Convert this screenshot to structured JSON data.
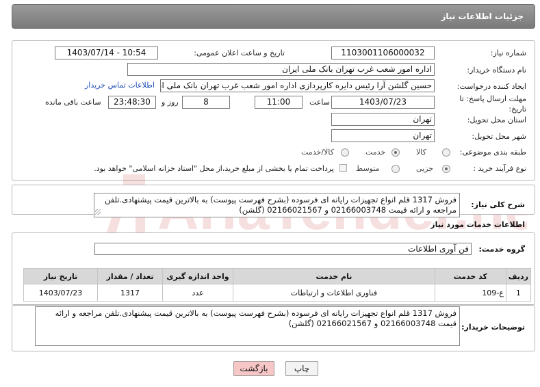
{
  "header": {
    "title": "جزئیات اطلاعات نیاز"
  },
  "form": {
    "need_number_label": "شماره نیاز:",
    "need_number": "1103001106000032",
    "announce_label": "تاریخ و ساعت اعلان عمومی:",
    "announce_value": "1403/07/14 - 10:54",
    "buyer_org_label": "نام دستگاه خریدار:",
    "buyer_org": "اداره امور شعب غرب تهران بانک ملی ایران",
    "requester_label": "ایجاد کننده درخواست:",
    "requester": "حسین گلشن آرا رئیس دایره کارپردازی اداره امور شعب غرب تهران بانک ملی ایرا",
    "buyer_contact_link": "اطلاعات تماس خریدار",
    "deadline_label": "مهلت ارسال پاسخ: تا تاریخ:",
    "deadline_date": "1403/07/23",
    "time_label": "ساعت",
    "deadline_time": "11:00",
    "days_count": "8",
    "days_label": "روز و",
    "remaining_time": "23:48:30",
    "remaining_label": "ساعت باقی مانده",
    "province_label": "استان محل تحویل:",
    "province": "تهران",
    "city_label": "شهر محل تحویل:",
    "city": "تهران",
    "category_label": "طبقه بندی موضوعی:",
    "category_options": [
      "کالا",
      "خدمت",
      "کالا/خدمت"
    ],
    "category_selected": "خدمت",
    "process_label": "نوع فرآیند خرید :",
    "process_options": [
      "جزیی",
      "متوسط"
    ],
    "process_selected": "جزیی",
    "payment_note": "پرداخت تمام یا بخشی از مبلغ خرید،از محل \"اسناد خزانه اسلامی\" خواهد بود."
  },
  "description": {
    "label": "شرح کلی نیاز:",
    "text": "فروش 1317 قلم انواع تجهیزات رایانه ای فرسوده (بشرح فهرست پیوست) به بالاترین قیمت پیشنهادی.تلفن مراجعه و ارائه قیمت 02166003748 و 02166021567  (گلشن)"
  },
  "services": {
    "section_title": "اطلاعات خدمات مورد نیاز",
    "group_label": "گروه خدمت:",
    "group_value": "فن آوری اطلاعات",
    "columns": [
      "ردیف",
      "کد خدمت",
      "نام خدمت",
      "واحد اندازه گیری",
      "تعداد / مقدار",
      "تاریخ نیاز"
    ],
    "rows": [
      {
        "row": "1",
        "code": "ع-109",
        "name": "فناوری اطلاعات و ارتباطات",
        "unit": "عدد",
        "qty": "1317",
        "date": "1403/07/23"
      }
    ]
  },
  "buyer_notes": {
    "label": "توضیحات خریدار:",
    "text": "فروش 1317 قلم انواع تجهیزات رایانه ای فرسوده (بشرح فهرست پیوست) به بالاترین قیمت پیشنهادی.تلفن مراجعه و ارائه قیمت 02166003748 و 02166021567  (گلشن)"
  },
  "buttons": {
    "print": "چاپ",
    "back": "بازگشت"
  },
  "watermark": {
    "text": "AriaTender.neT"
  },
  "colors": {
    "title_bg": "#8a8a8a",
    "link": "#1f4fb4",
    "back_button": "#f7c6c6",
    "watermark": "#c62828"
  }
}
